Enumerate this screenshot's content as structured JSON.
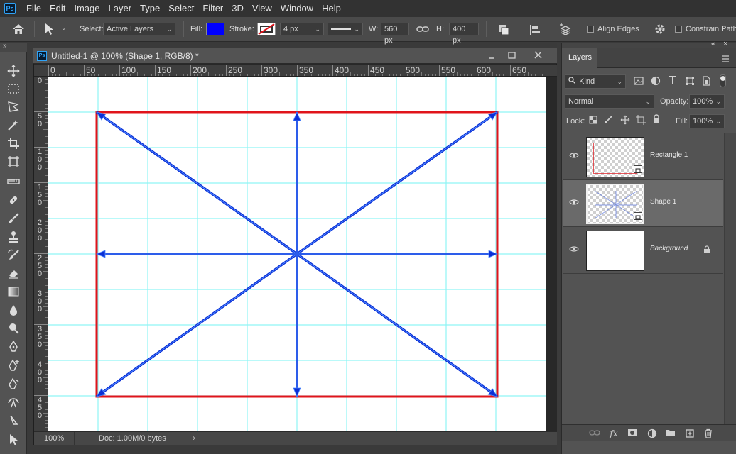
{
  "menu": {
    "logo": "Ps",
    "items": [
      "File",
      "Edit",
      "Image",
      "Layer",
      "Type",
      "Select",
      "Filter",
      "3D",
      "View",
      "Window",
      "Help"
    ]
  },
  "options": {
    "select_label": "Select:",
    "select_value": "Active Layers",
    "fill_label": "Fill:",
    "fill_color": "#0000ff",
    "stroke_label": "Stroke:",
    "stroke_width": "4 px",
    "w_label": "W:",
    "w_value": "560 px",
    "h_label": "H:",
    "h_value": "400 px",
    "align_edges_label": "Align Edges",
    "constrain_label": "Constrain Path D"
  },
  "document": {
    "title": "Untitled-1 @ 100% (Shape 1, RGB/8) *",
    "zoom": "100%",
    "doc_info": "Doc: 1.00M/0 bytes",
    "ruler_h_labels": [
      "0",
      "50",
      "100",
      "150",
      "200",
      "250",
      "300",
      "350",
      "400",
      "450",
      "500",
      "550",
      "600",
      "650"
    ],
    "ruler_v_labels": [
      "0",
      "5\n0",
      "1\n0\n0",
      "1\n5\n0",
      "2\n0\n0",
      "2\n5\n0",
      "3\n0\n0",
      "3\n5\n0",
      "4\n0\n0",
      "4\n5\n0"
    ],
    "guide_color": "#8ff5f5",
    "rect_stroke_color": "#e0141b",
    "arrow_color": "#0b2fd6"
  },
  "layers_panel": {
    "title": "Layers",
    "kind_label": "Kind",
    "blend_mode": "Normal",
    "opacity_label": "Opacity:",
    "opacity_value": "100%",
    "lock_label": "Lock:",
    "fill_label": "Fill:",
    "fill_value": "100%",
    "layers": [
      {
        "name": "Rectangle 1",
        "selected": false
      },
      {
        "name": "Shape 1",
        "selected": true
      },
      {
        "name": "Background",
        "selected": false
      }
    ]
  }
}
